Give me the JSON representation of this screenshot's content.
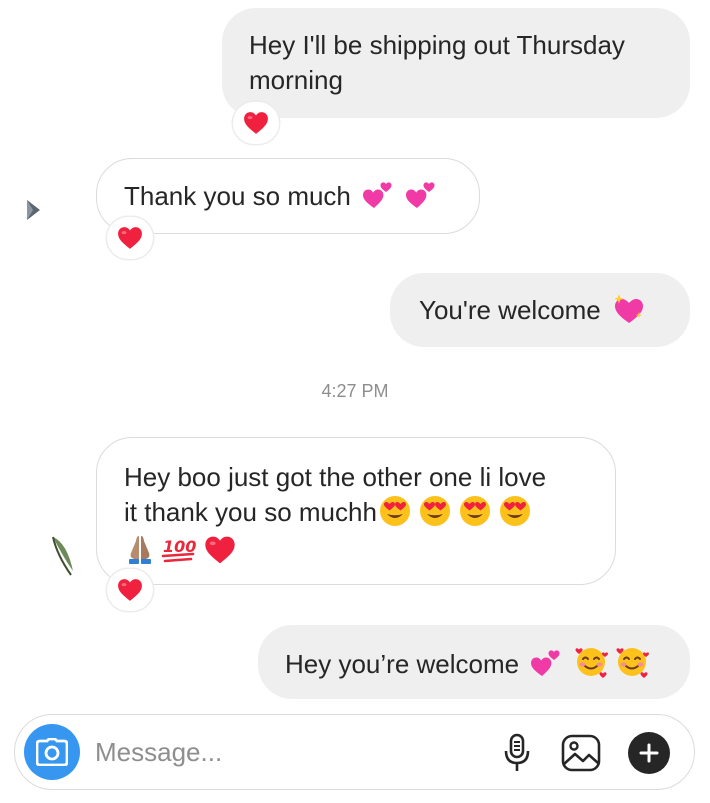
{
  "thread": {
    "messages": [
      {
        "id": "m1",
        "direction": "outgoing",
        "text": "Hey I'll be shipping out Thursday\nmorning",
        "emojis": [],
        "reaction": "red-heart"
      },
      {
        "id": "m2",
        "direction": "incoming",
        "text": "Thank you so much",
        "emojis": [
          "two-hearts",
          "two-hearts"
        ],
        "reaction": "red-heart"
      },
      {
        "id": "m3",
        "direction": "outgoing",
        "text": "You're welcome",
        "emojis": [
          "sparkling-heart"
        ],
        "reaction": null
      },
      {
        "id": "m4",
        "direction": "incoming",
        "text": "Hey boo just got the other one li love\nit thank you so muchh",
        "emojis": [
          "heart-eyes",
          "heart-eyes",
          "heart-eyes",
          "heart-eyes",
          "folded-hands",
          "hundred-points",
          "red-heart"
        ],
        "reaction": "red-heart"
      },
      {
        "id": "m5",
        "direction": "outgoing",
        "text": "Hey you’re welcome",
        "emojis": [
          "two-hearts",
          "smiling-face-with-hearts",
          "smiling-face-with-hearts"
        ],
        "reaction": null
      }
    ],
    "timestamp": "4:27 PM"
  },
  "composer": {
    "placeholder": "Message...",
    "camera_icon": "camera-icon",
    "mic_icon": "microphone-icon",
    "gallery_icon": "gallery-icon",
    "plus_icon": "plus-icon"
  },
  "colors": {
    "outgoing_bubble": "#efefef",
    "incoming_border": "#dbdbdb",
    "camera_button": "#3797f0",
    "heart": "#f0213f",
    "text": "#262626",
    "muted": "#8e8e8e"
  }
}
